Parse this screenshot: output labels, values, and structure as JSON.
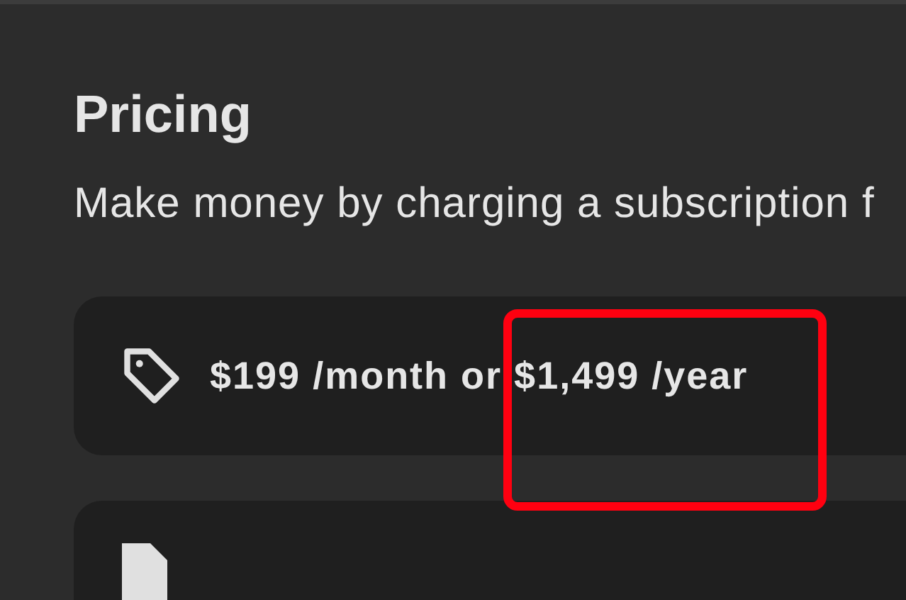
{
  "section": {
    "title": "Pricing",
    "description": "Make money by charging a subscription f"
  },
  "options": [
    {
      "kind": "price",
      "text": "$199 /month or $1,499 /year"
    },
    {
      "kind": "document"
    }
  ]
}
